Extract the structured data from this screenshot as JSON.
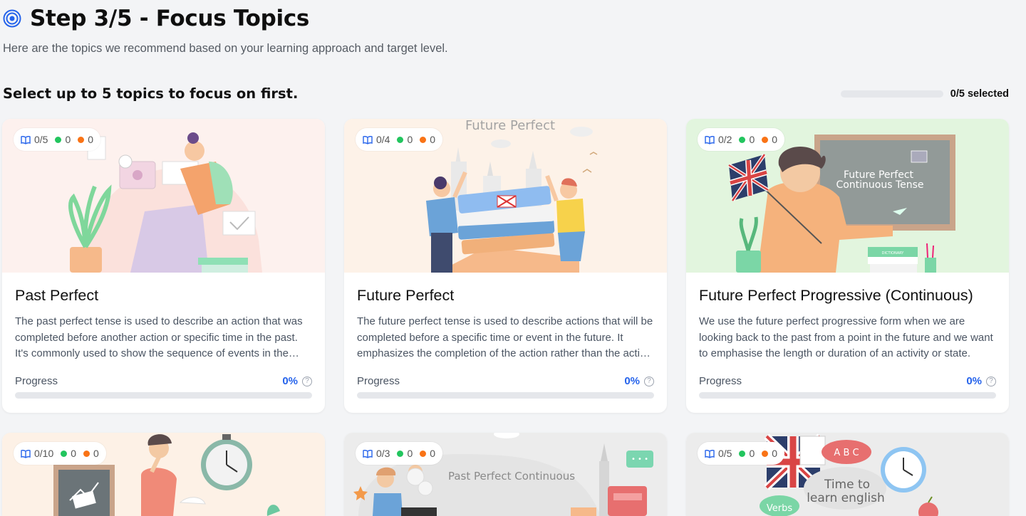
{
  "header": {
    "title": "Step 3/5 - Focus Topics",
    "subtitle": "Here are the topics we recommend based on your learning approach and target level."
  },
  "selection": {
    "heading": "Select up to 5 topics to focus on first.",
    "selected_label": "0/5 selected",
    "selected_fraction": 0
  },
  "colors": {
    "accent": "#2563eb",
    "green_dot": "#22c55e",
    "orange_dot": "#f97316"
  },
  "progress_label": "Progress",
  "topics": [
    {
      "title": "Past Perfect",
      "description": "The past perfect tense is used to describe an action that was completed before another action or specific time in the past. It's commonly used to show the sequence of events in the past.",
      "lessons": "0/5",
      "green": "0",
      "orange": "0",
      "progress": "0%",
      "progress_fraction": 0,
      "illustration": "person-with-tablet"
    },
    {
      "title": "Future Perfect",
      "description": "The future perfect tense is used to describe actions that will be completed before a specific time or event in the future. It emphasizes the completion of the action rather than the action itself.",
      "lessons": "0/4",
      "green": "0",
      "orange": "0",
      "progress": "0%",
      "progress_fraction": 0,
      "illustration": "students-with-books",
      "image_text": "Future Perfect"
    },
    {
      "title": "Future Perfect Progressive (Continuous)",
      "description": "We use the future perfect progressive form when we are looking back to the past from a point in the future and we want to emphasise the length or duration of an activity or state.",
      "lessons": "0/2",
      "green": "0",
      "orange": "0",
      "progress": "0%",
      "progress_fraction": 0,
      "illustration": "teacher-at-chalkboard",
      "image_text_line1": "Future Perfect",
      "image_text_line2": "Continuous Tense",
      "image_small_text": "DICTIONARY"
    },
    {
      "lessons": "0/10",
      "green": "0",
      "orange": "0",
      "illustration": "thinking-man-clock"
    },
    {
      "lessons": "0/3",
      "green": "0",
      "orange": "0",
      "illustration": "girl-at-laptop",
      "image_text": "Past Perfect Continuous"
    },
    {
      "lessons": "0/5",
      "green": "0",
      "orange": "0",
      "illustration": "learn-english-collage",
      "image_text_line1": "Time to",
      "image_text_line2": "learn english",
      "image_small_text": "A B C",
      "image_badge_text": "Verbs"
    }
  ]
}
